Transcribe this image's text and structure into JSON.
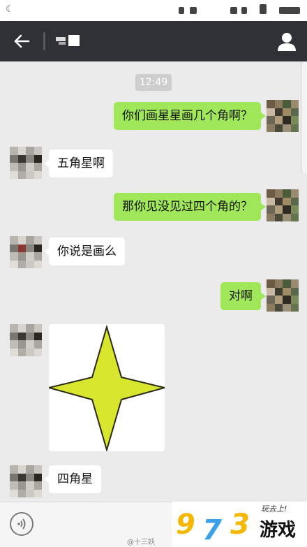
{
  "header": {
    "title_masked": ""
  },
  "chat": {
    "timestamp": "12:49",
    "messages": [
      {
        "from": "me",
        "text": "你们画星星画几个角啊？"
      },
      {
        "from": "them",
        "text": "五角星啊"
      },
      {
        "from": "me",
        "text": "那你见没见过四个角的？"
      },
      {
        "from": "them",
        "text": "你说是画么"
      },
      {
        "from": "me",
        "text": "对啊"
      },
      {
        "from": "them",
        "image": "four-pointed-star"
      },
      {
        "from": "them",
        "text": "四角星"
      }
    ]
  },
  "watermark": "@十三妖",
  "brand": {
    "digit1": "9",
    "digit2": "7",
    "digit3": "3",
    "name": "游戏",
    "tagline": "玩去上!"
  },
  "colors": {
    "my_bubble": "#a0e75a",
    "their_bubble": "#ffffff",
    "titlebar": "#2e3236",
    "star": "#d9e62e"
  }
}
